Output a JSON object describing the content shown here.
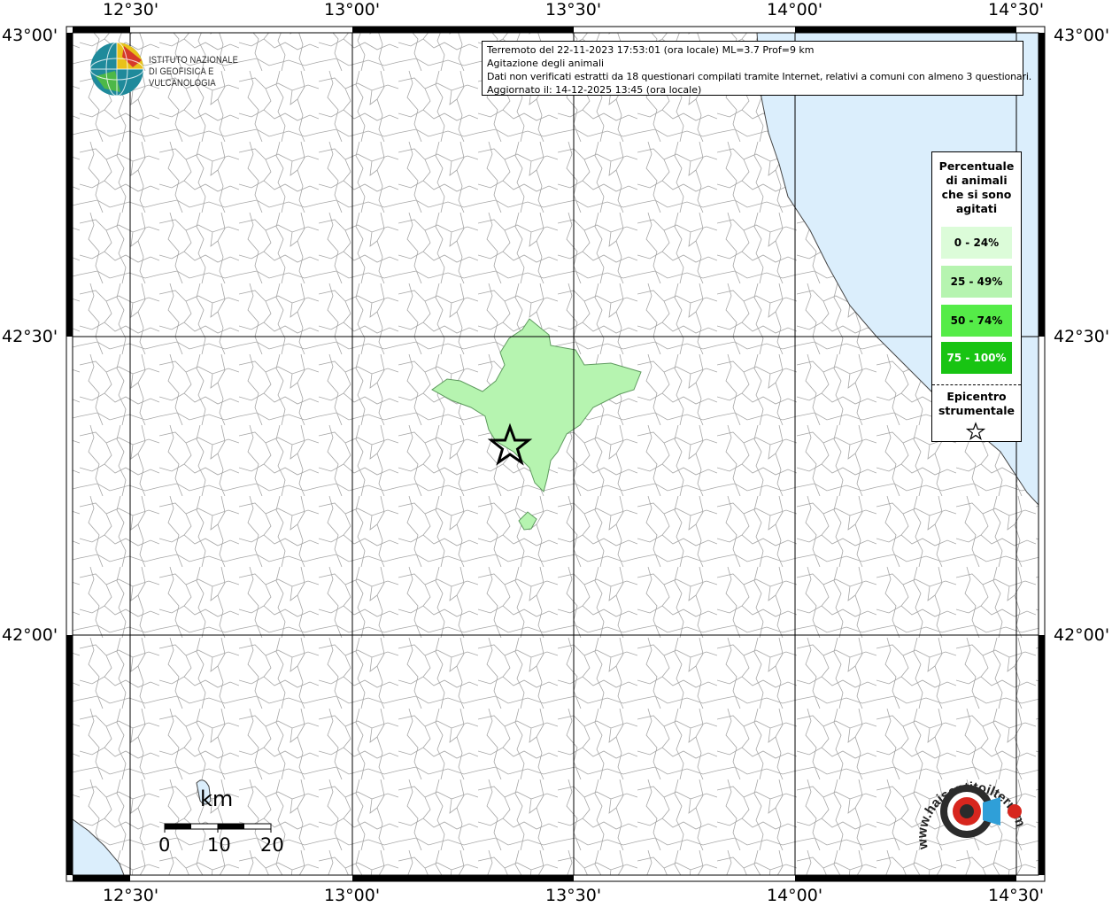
{
  "map": {
    "info_lines": [
      "Terremoto del 22-11-2023 17:53:01 (ora locale) ML=3.7 Prof=9 km",
      "Agitazione degli animali",
      "Dati non verificati estratti da 18 questionari compilati tramite Internet, relativi a comuni con almeno 3 questionari.",
      "Aggiornato il: 14-12-2025 13:45 (ora locale)"
    ],
    "lon_labels": [
      "12°30'",
      "13°00'",
      "13°30'",
      "14°00'",
      "14°30'"
    ],
    "lat_labels": [
      "43°00'",
      "42°30'",
      "42°00'"
    ],
    "colors": {
      "sea": "#dbeefc",
      "land": "#ffffff",
      "boundary": "#9a9a9a",
      "grid": "#000000",
      "felt_area": "#b6f4b0",
      "felt_border": "#5f9a5f"
    }
  },
  "logo": {
    "line1": "ISTITUTO NAZIONALE",
    "line2": "DI GEOFISICA E VULCANOLOGIA"
  },
  "legend": {
    "title_lines": [
      "Percentuale",
      "di animali",
      "che si sono",
      "agitati"
    ],
    "items": [
      {
        "label": "0 - 24%",
        "color": "#dcfcd9"
      },
      {
        "label": "25 - 49%",
        "color": "#b6f4b0"
      },
      {
        "label": "50 - 74%",
        "color": "#55ec48"
      },
      {
        "label": "75 - 100%",
        "color": "#18c413"
      }
    ],
    "epicenter_lines": [
      "Epicentro",
      "strumentale"
    ],
    "star_icon": "star-outline-icon"
  },
  "scale_bar": {
    "unit": "km",
    "labels": [
      "0",
      "10",
      "20"
    ]
  },
  "brand": {
    "name": "www.haisentitoilterremoto.it",
    "icon": "siren-megaphone-icon"
  }
}
